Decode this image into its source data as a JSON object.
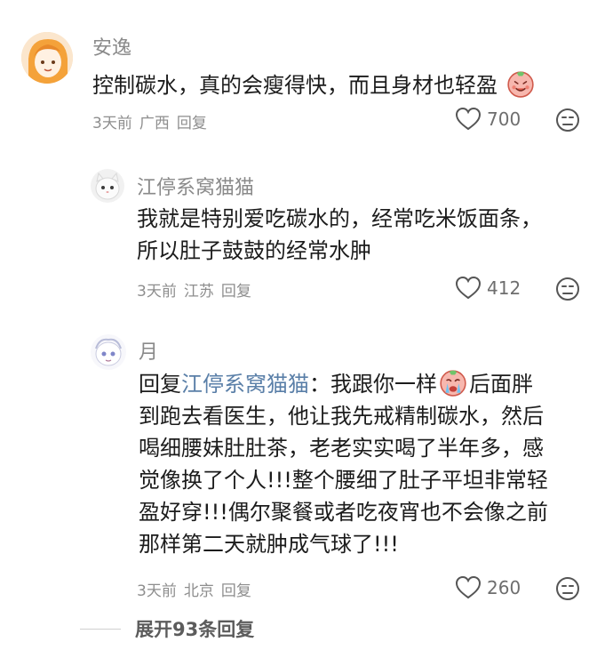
{
  "comments": [
    {
      "username": "安逸",
      "text": "控制碳水，真的会瘦得快，而且身材也轻盈",
      "time": "3天前",
      "location": "广西",
      "reply_label": "回复",
      "likes": "700"
    },
    {
      "username": "江停系窝猫猫",
      "line1": "我就是特别爱吃碳水的，经常吃米饭面条，",
      "line2": "所以肚子鼓鼓的经常水肿",
      "time": "3天前",
      "location": "江苏",
      "reply_label": "回复",
      "likes": "412"
    },
    {
      "username": "月",
      "reply_prefix": "回复",
      "mention": "江停系窝猫猫",
      "line1_a": "：我跟你一样",
      "line1_b": "后面胖",
      "line2": "到跑去看医生，他让我先戒精制碳水，然后",
      "line3": "喝细腰妹肚肚茶，老老实实喝了半年多，感",
      "line4": "觉像换了个人!!!整个腰细了肚子平坦非常轻",
      "line5": "盈好穿!!!偶尔聚餐或者吃夜宵也不会像之前",
      "line6": "那样第二天就肿成气球了!!!",
      "time": "3天前",
      "location": "北京",
      "reply_label": "回复",
      "likes": "260"
    }
  ],
  "expand_label": "展开93条回复"
}
